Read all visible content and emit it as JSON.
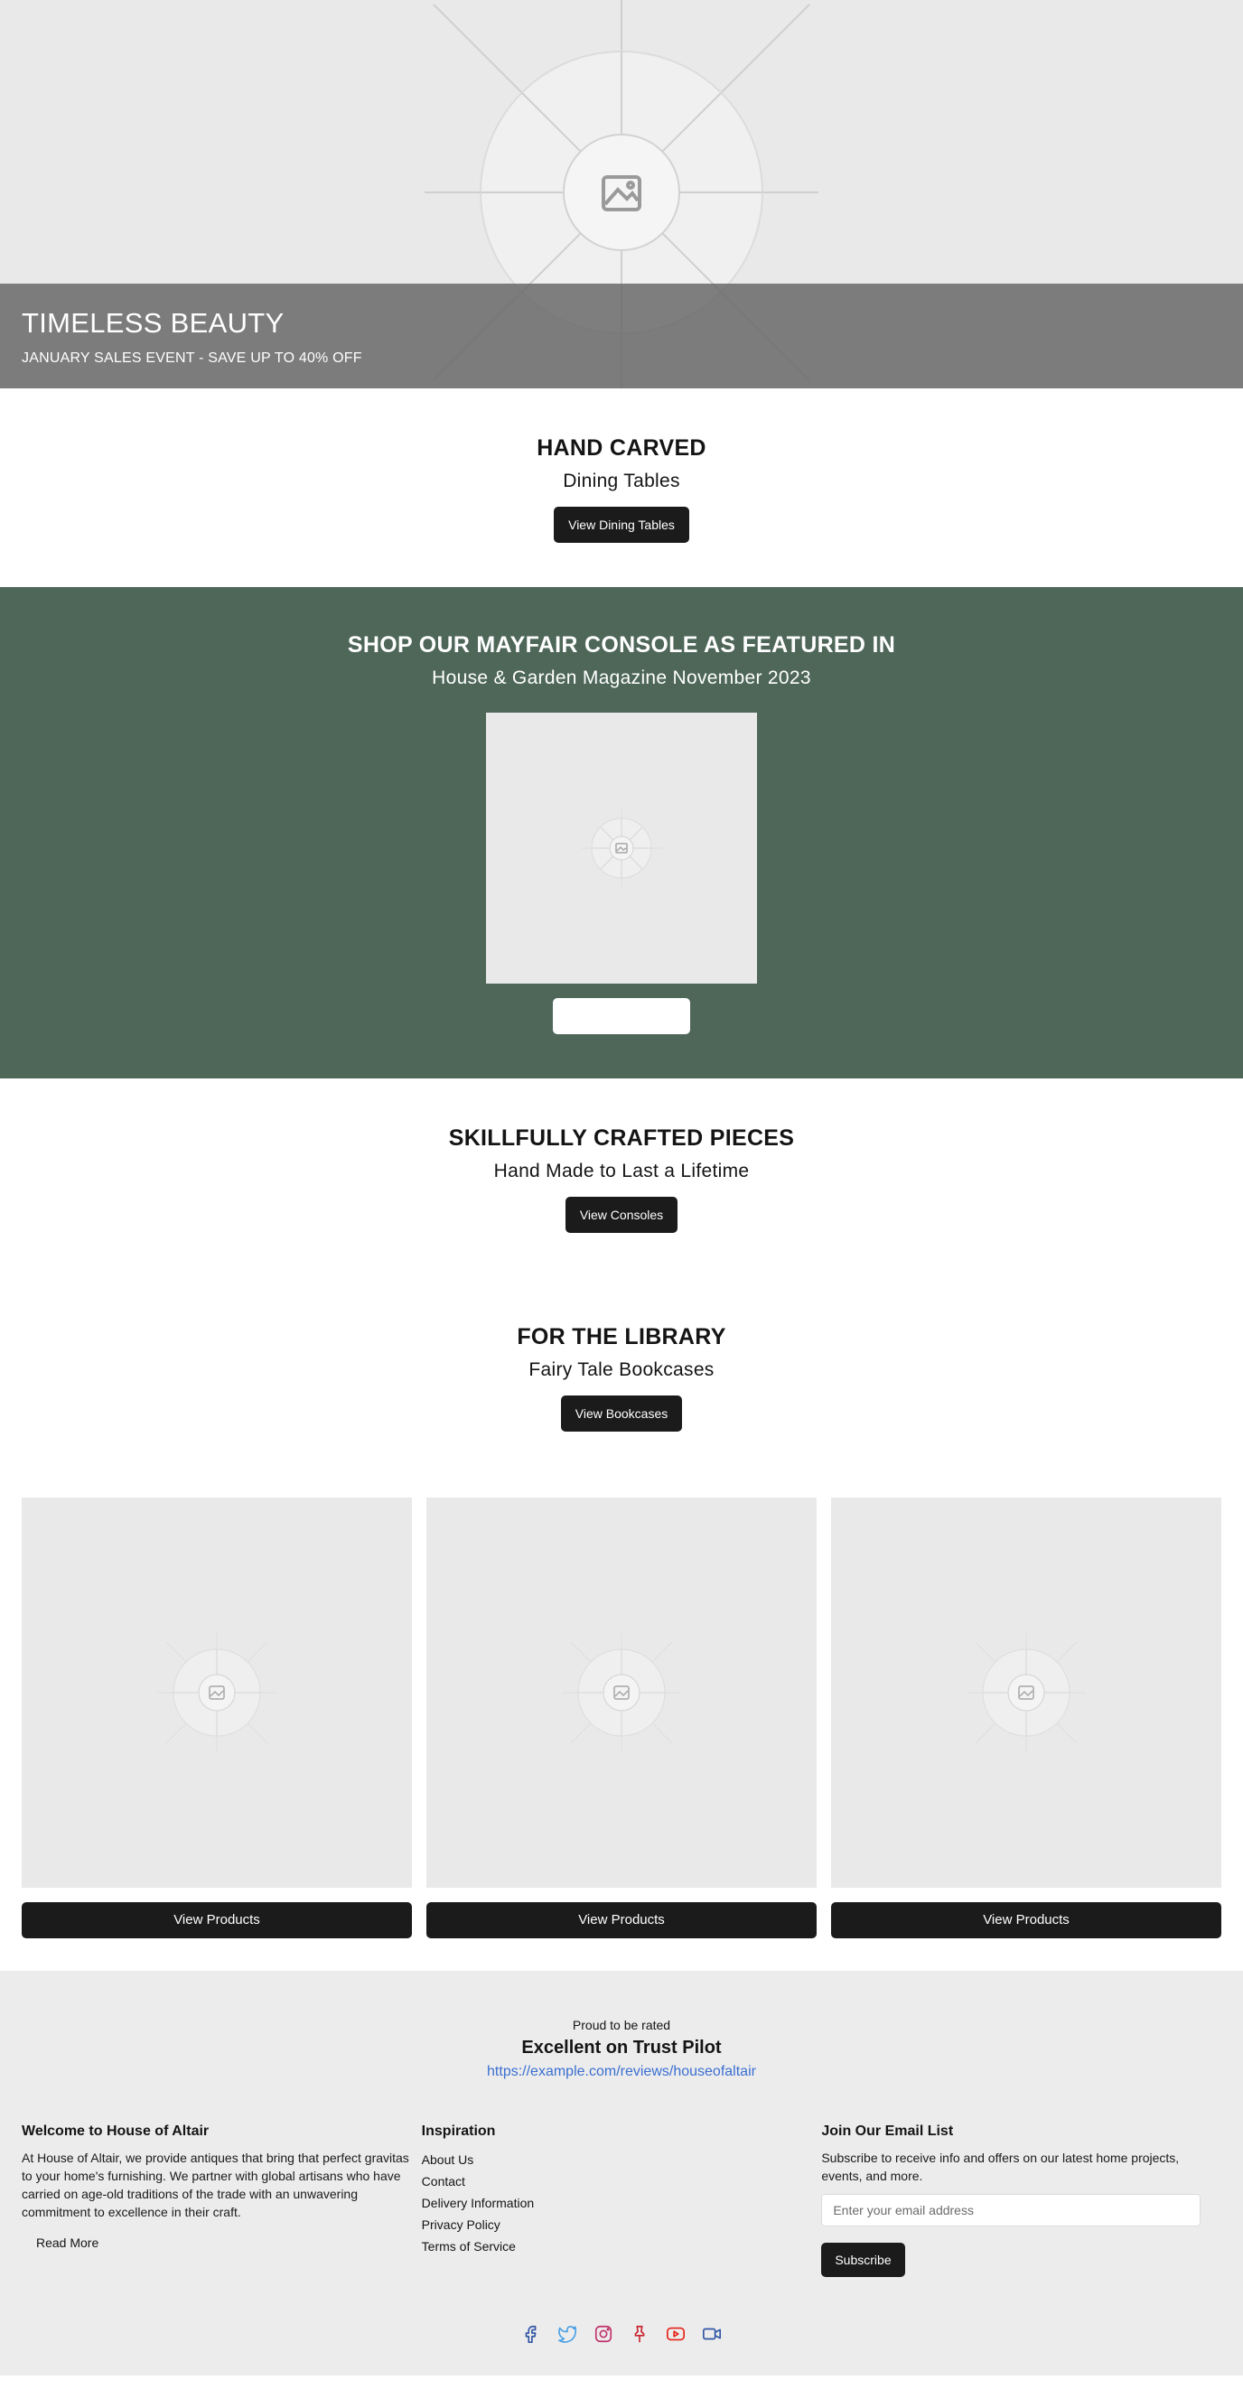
{
  "hero": {
    "title": "TIMELESS BEAUTY",
    "subtitle": "JANUARY SALES EVENT - SAVE UP TO 40% OFF"
  },
  "hand_carved": {
    "title": "HAND CARVED",
    "subtitle": "Dining Tables",
    "button": "View Dining Tables"
  },
  "featured": {
    "title": "SHOP OUR MAYFAIR CONSOLE AS FEATURED IN",
    "subtitle": "House & Garden Magazine November 2023",
    "button": ""
  },
  "crafted": {
    "title": "SKILLFULLY CRAFTED PIECES",
    "subtitle": "Hand Made to Last a Lifetime",
    "button": "View Consoles"
  },
  "library": {
    "title": "FOR THE LIBRARY",
    "subtitle": "Fairy Tale Bookcases",
    "button": "View Bookcases"
  },
  "products": [
    {
      "button": "View Products"
    },
    {
      "button": "View Products"
    },
    {
      "button": "View Products"
    }
  ],
  "footer": {
    "trust_pre": "Proud to be rated",
    "trust_title": "Excellent on Trust Pilot",
    "trust_link": "https://example.com/reviews/houseofaltair",
    "about": {
      "heading": "Welcome to House of Altair",
      "text": "At House of Altair, we provide antiques that bring that perfect gravitas to your home's furnishing. We partner with global artisans who have carried on age-old traditions of the trade with an unwavering commitment to excellence in their craft.",
      "read_more": "Read More"
    },
    "inspiration": {
      "heading": "Inspiration",
      "links": [
        "About Us",
        "Contact",
        "Delivery Information",
        "Privacy Policy",
        "Terms of Service"
      ]
    },
    "email": {
      "heading": "Join Our Email List",
      "text": "Subscribe to receive info and offers on our latest home projects, events, and more.",
      "placeholder": "Enter your email address",
      "button": "Subscribe"
    },
    "social_icons": [
      "facebook-icon",
      "twitter-icon",
      "instagram-icon",
      "pinterest-icon",
      "youtube-icon",
      "video-icon"
    ]
  },
  "colors": {
    "featured_bg": "#4e6759",
    "button_dark": "#1b1b1c",
    "link_blue": "#3b6fd1",
    "footer_bg": "#ececec",
    "placeholder_bg": "#e9e9e9"
  }
}
